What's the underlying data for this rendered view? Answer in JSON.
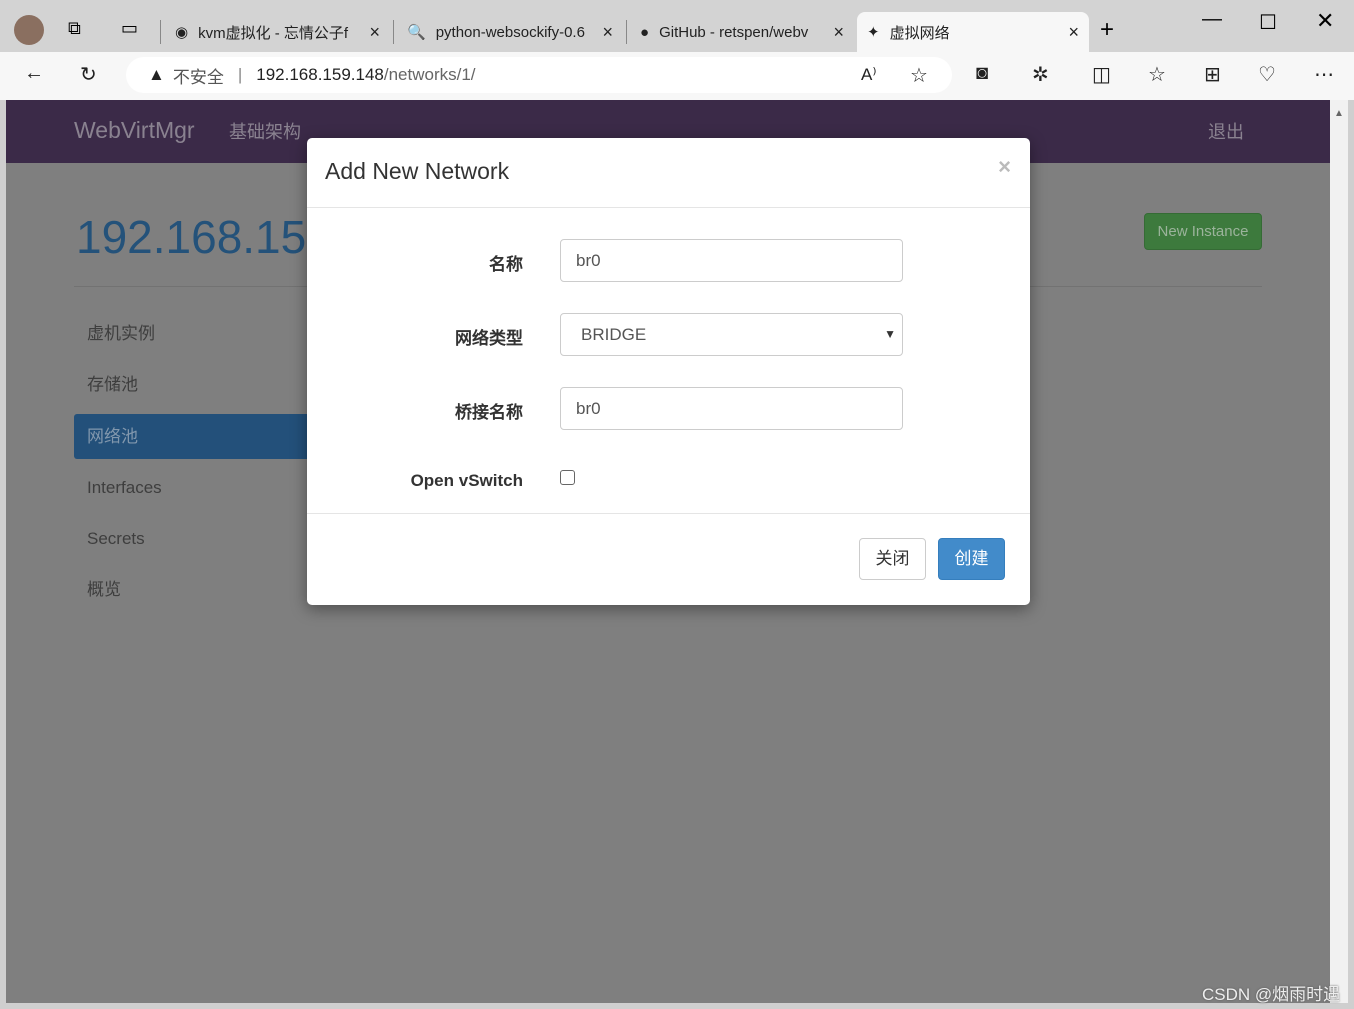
{
  "browser": {
    "tabs": [
      {
        "title": "kvm虚拟化 - 忘情公子f"
      },
      {
        "title": "python-websockify-0.6"
      },
      {
        "title": "GitHub - retspen/webv"
      },
      {
        "title": "虚拟网络"
      }
    ],
    "security_label": "不安全",
    "url_host": "192.168.159.148",
    "url_path": "/networks/1/"
  },
  "navbar": {
    "brand": "WebVirtMgr",
    "menu": "基础架构",
    "logout": "退出"
  },
  "page": {
    "title": "192.168.159.148",
    "new_instance": "New Instance",
    "sidebar": [
      {
        "label": "虚机实例"
      },
      {
        "label": "存储池"
      },
      {
        "label": "网络池",
        "active": true
      },
      {
        "label": "Interfaces"
      },
      {
        "label": "Secrets"
      },
      {
        "label": "概览"
      }
    ]
  },
  "modal": {
    "title": "Add New Network",
    "close_symbol": "×",
    "fields": {
      "name_label": "名称",
      "name_value": "br0",
      "type_label": "网络类型",
      "type_value": "BRIDGE",
      "bridge_label": "桥接名称",
      "bridge_value": "br0",
      "ovs_label": "Open vSwitch",
      "ovs_checked": false
    },
    "close_button": "关闭",
    "create_button": "创建"
  },
  "watermark": "CSDN @烟雨时遇",
  "colors": {
    "primary": "#428bca",
    "success": "#3d7a3d",
    "navbar": "#3b2a48"
  }
}
